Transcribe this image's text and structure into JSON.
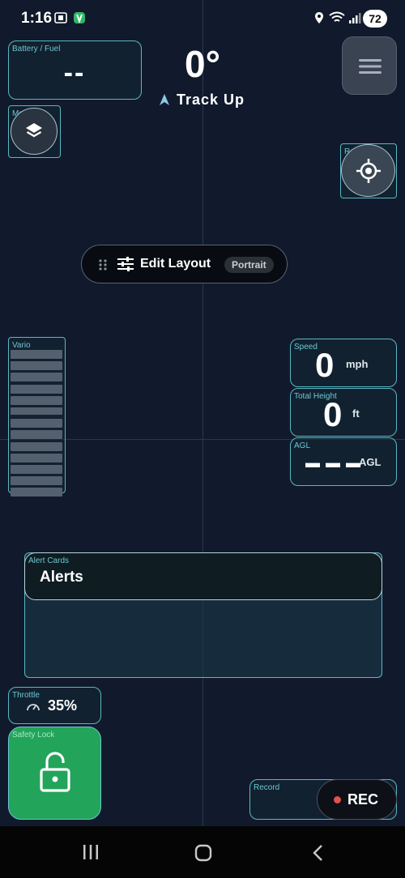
{
  "status_bar": {
    "time": "1:16",
    "battery": "72"
  },
  "heading": {
    "degrees": "0°",
    "mode": "Track Up"
  },
  "battery_widget": {
    "label": "Battery / Fuel",
    "value": "--"
  },
  "map_layers": {
    "label": "Map La..."
  },
  "recenter": {
    "label": "Re-center"
  },
  "edit_layout": {
    "label": "Edit Layout",
    "badge": "Portrait"
  },
  "vario": {
    "label": "Vario"
  },
  "speed": {
    "label": "Speed",
    "value": "0",
    "unit": "mph"
  },
  "total_height": {
    "label": "Total Height",
    "value": "0",
    "unit": "ft"
  },
  "agl": {
    "label": "AGL",
    "value": "▬ ▬ ▬",
    "unit": "AGL"
  },
  "alerts": {
    "panel_label": "Alert Cards",
    "title": "Alerts"
  },
  "throttle": {
    "label": "Throttle",
    "value": "35%"
  },
  "safety_lock": {
    "label": "Safety Lock"
  },
  "record": {
    "label": "Record",
    "button": "REC"
  },
  "colors": {
    "accent": "#5db6c4",
    "lock_green": "#22a45a",
    "rec_red": "#e0524a"
  }
}
